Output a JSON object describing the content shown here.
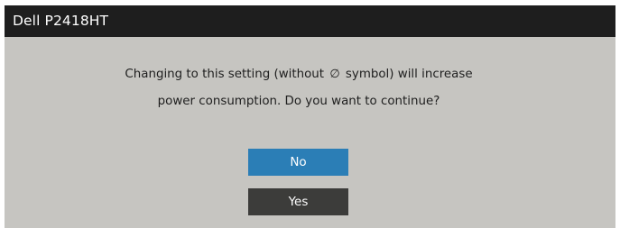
{
  "title": "Dell P2418HT",
  "message": {
    "line1_before": "Changing to this setting (without",
    "icon_glyph": "∅",
    "icon_name": "energy-saving-icon",
    "line1_after": "symbol) will increase",
    "line2": "power consumption. Do you want to continue?"
  },
  "buttons": {
    "no_label": "No",
    "yes_label": "Yes"
  },
  "colors": {
    "title_bg": "#1e1e1e",
    "dialog_bg": "#c6c5c1",
    "selected_button": "#2b7eb6",
    "button": "#3c3c3a"
  }
}
